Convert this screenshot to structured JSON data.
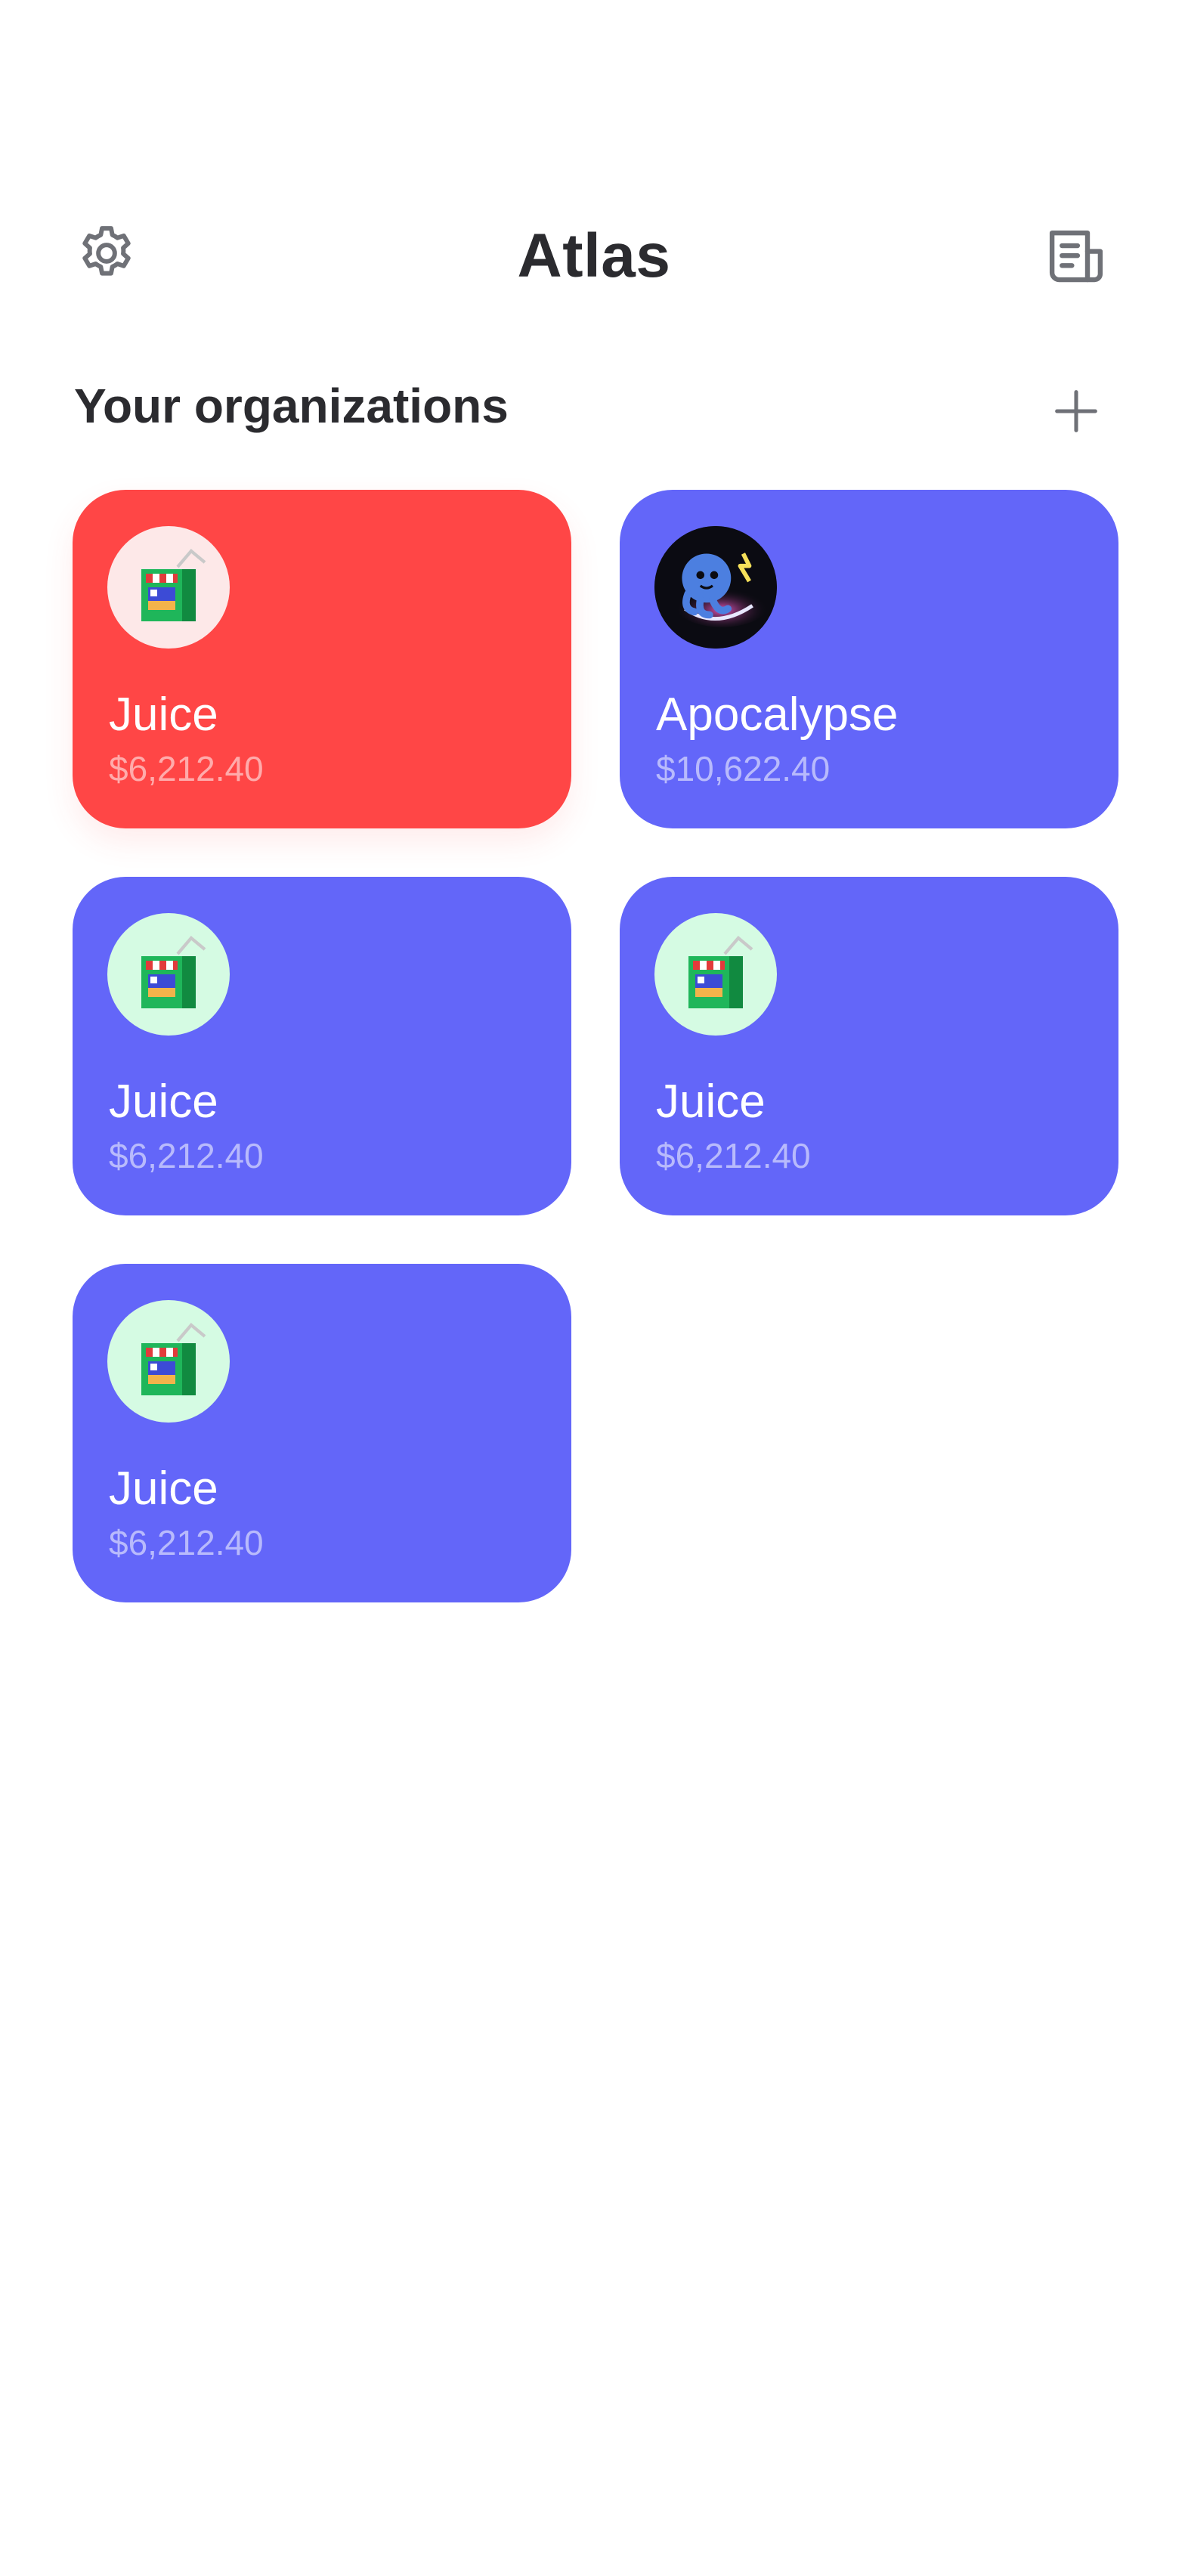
{
  "header": {
    "title": "Atlas",
    "left_icon": "gear-icon",
    "right_icon": "document-icon"
  },
  "organizations": {
    "title": "Your organizations",
    "add_icon": "plus-icon",
    "items": [
      {
        "name": "Juice",
        "amount": "$6,212.40",
        "color": "#ff4646",
        "icon": "juice-box-icon"
      },
      {
        "name": "Apocalypse",
        "amount": "$10,622.40",
        "color": "#6366f9",
        "icon": "octopus-icon"
      },
      {
        "name": "Juice",
        "amount": "$6,212.40",
        "color": "#6366f9",
        "icon": "juice-box-icon"
      },
      {
        "name": "Juice",
        "amount": "$6,212.40",
        "color": "#6366f9",
        "icon": "juice-box-icon"
      },
      {
        "name": "Juice",
        "amount": "$6,212.40",
        "color": "#6366f9",
        "icon": "juice-box-icon"
      }
    ]
  }
}
